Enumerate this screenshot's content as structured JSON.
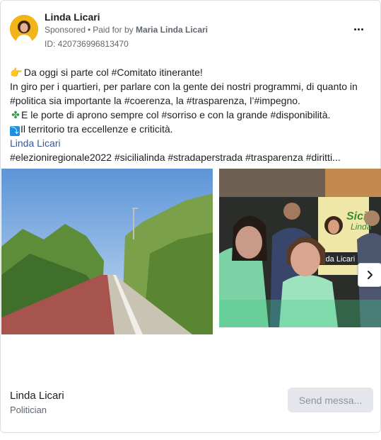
{
  "ad": {
    "page_name": "Linda Licari",
    "sponsored": "Sponsored",
    "paid_for_prefix": "Paid for by",
    "paid_for_name": "Maria Linda Licari",
    "ad_id": "ID: 420736996813470"
  },
  "body": {
    "line1": "Da oggi si parte col #Comitato itinerante!",
    "line2": "In giro per i quartieri, per parlare con la gente dei nostri programmi, di quanto in",
    "line3": "#politica sia importante la #coerenza, la #trasparenza, l’#impegno.",
    "line4": "E le porte di aprono sempre col #sorriso e con la grande #disponibilità.",
    "line5": "Il territorio tra eccellenze e criticità.",
    "line6": "Linda Licari",
    "line7": "#elezioniregionale2022 #sicilialinda #stradaperstrada #trasparenza #diritti..."
  },
  "poster": {
    "line1": "Sicilia",
    "line2": "Linda",
    "line3": "inda Licari"
  },
  "footer": {
    "name": "Linda Licari",
    "category": "Politician",
    "send_label": "Send messa..."
  },
  "icons": {
    "more": "more-options-icon",
    "next": "chevron-right-icon",
    "hand": "pointing-hand-icon",
    "clover": "clover-icon",
    "arrow": "arrow-square-icon"
  },
  "colors": {
    "link": "#385898",
    "secondary_text": "#65676b",
    "button_bg": "#e4e6eb"
  }
}
